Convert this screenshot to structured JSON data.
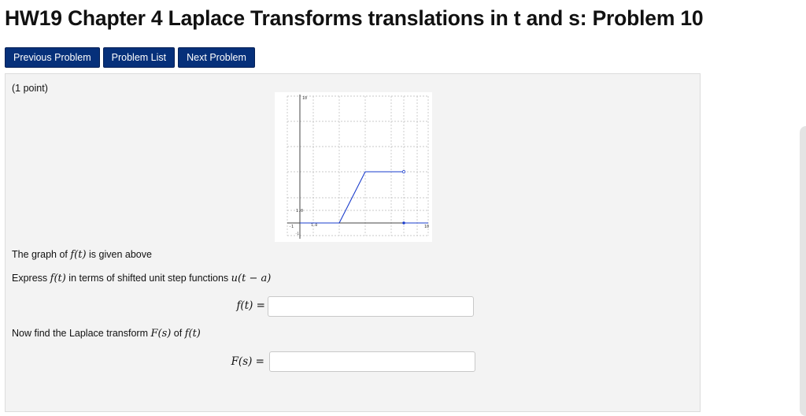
{
  "page": {
    "title": "HW19 Chapter 4 Laplace Transforms translations in t and s: Problem 10"
  },
  "nav": {
    "previous": "Previous Problem",
    "list": "Problem List",
    "next": "Next Problem"
  },
  "problem": {
    "points": "(1 point)",
    "graph_caption_prefix": "The graph of ",
    "graph_caption_fn": "f(t)",
    "graph_caption_suffix": " is given above",
    "express_prefix": "Express ",
    "express_fn": "f(t)",
    "express_middle": " in terms of shifted unit step functions ",
    "express_step": "u(t − a)",
    "answer1_label": "f(t) =",
    "answer1_value": "",
    "laplace_prefix": "Now find the Laplace transform ",
    "laplace_Fs": "F(s)",
    "laplace_of": " of ",
    "laplace_ft": "f(t)",
    "answer2_label": "F(s) =",
    "answer2_value": ""
  },
  "graph_labels": {
    "y_top": "10",
    "y_mid": "1.0",
    "x_left": "-1",
    "x_tick": "1.0",
    "x_right": "10",
    "y_bottom": "-1"
  },
  "colors": {
    "nav_button": "#06307a",
    "function_line": "#1a3ccc"
  }
}
